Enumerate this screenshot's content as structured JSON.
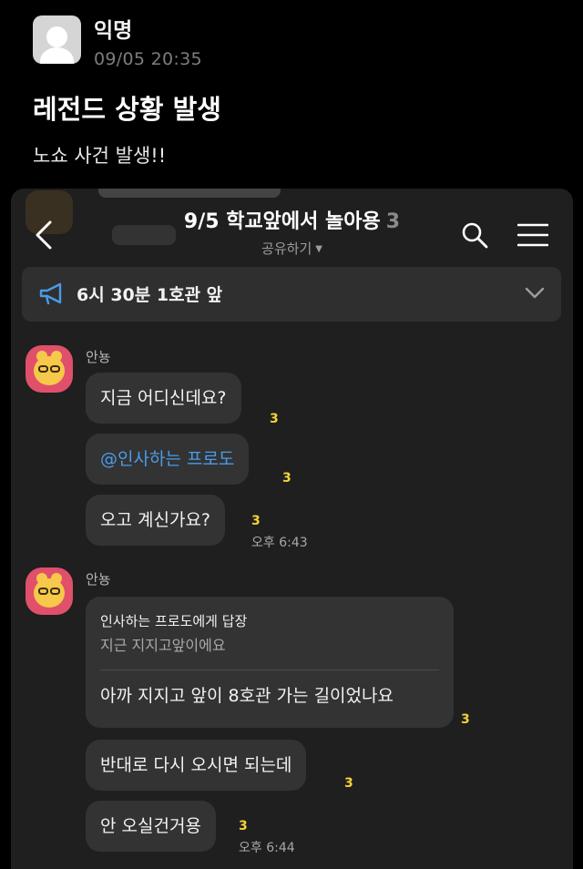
{
  "post": {
    "author": "익명",
    "time": "09/05 20:35",
    "title": "레전드 상황 발생",
    "body": "노쇼 사건 발생!!"
  },
  "chat": {
    "room_title": "9/5 학교앞에서 놀아용",
    "member_count": "3",
    "share_label": "공유하기",
    "notice": "6시 30분 1호관 앞",
    "messages_group1": {
      "sender": "안뇽",
      "bubbles": [
        {
          "text": "지금 어디신데요?",
          "unread": "3"
        },
        {
          "text": "@인사하는 프로도",
          "unread": "3"
        },
        {
          "text": "오고 계신가요?",
          "unread": "3",
          "time": "오후 6:43"
        }
      ]
    },
    "messages_group2": {
      "sender": "안뇽",
      "reply": {
        "header": "인사하는 프로도에게 답장",
        "quote": "지근 지지고앞이에요",
        "text": "아까 지지고 앞이 8호관 가는 길이었나요",
        "unread": "3"
      },
      "bubbles": [
        {
          "text": "반대로 다시 오시면 되는데",
          "unread": "3"
        },
        {
          "text": "안 오실건거용",
          "unread": "3",
          "time": "오후 6:44"
        }
      ]
    }
  },
  "colors": {
    "background": "#000000",
    "chat_bg": "#1f1f1f",
    "bubble": "#333333",
    "unread": "#f7d23a",
    "mention": "#4a9be8",
    "avatar_bg": "#e0506a"
  },
  "icons": [
    "default-avatar-icon",
    "back-arrow-icon",
    "search-icon",
    "menu-icon",
    "megaphone-icon",
    "chevron-down-icon",
    "kakao-character-icon"
  ]
}
